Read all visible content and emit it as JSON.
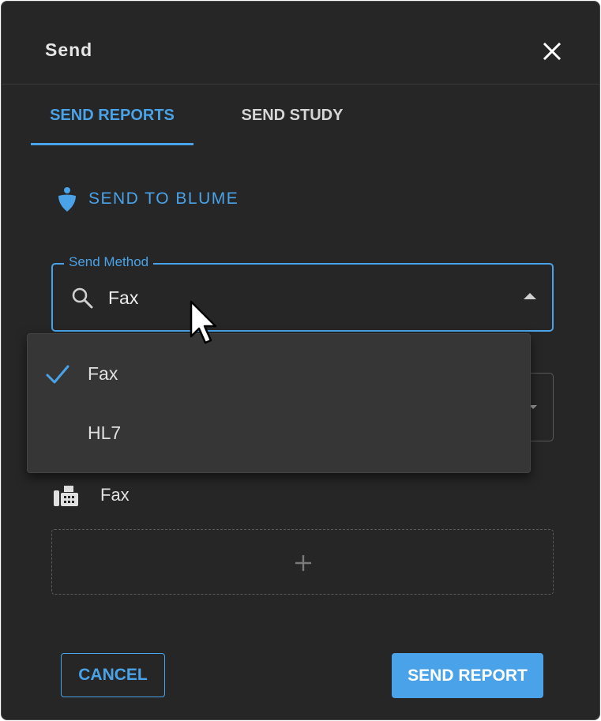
{
  "dialog": {
    "title": "Send"
  },
  "tabs": [
    {
      "label": "SEND REPORTS",
      "active": true
    },
    {
      "label": "SEND STUDY",
      "active": false
    }
  ],
  "blume": {
    "label": "SEND TO BLUME",
    "icon": "blume-drop-icon"
  },
  "send_method": {
    "label": "Send Method",
    "value": "Fax",
    "options": [
      {
        "label": "Fax",
        "selected": true
      },
      {
        "label": "HL7",
        "selected": false
      }
    ]
  },
  "recipient": {
    "icon": "fax-machine-icon",
    "label": "Fax"
  },
  "footer": {
    "cancel_label": "CANCEL",
    "send_label": "SEND REPORT"
  },
  "colors": {
    "accent": "#4aa3e8",
    "background": "#262626",
    "dropdown": "#363636"
  }
}
